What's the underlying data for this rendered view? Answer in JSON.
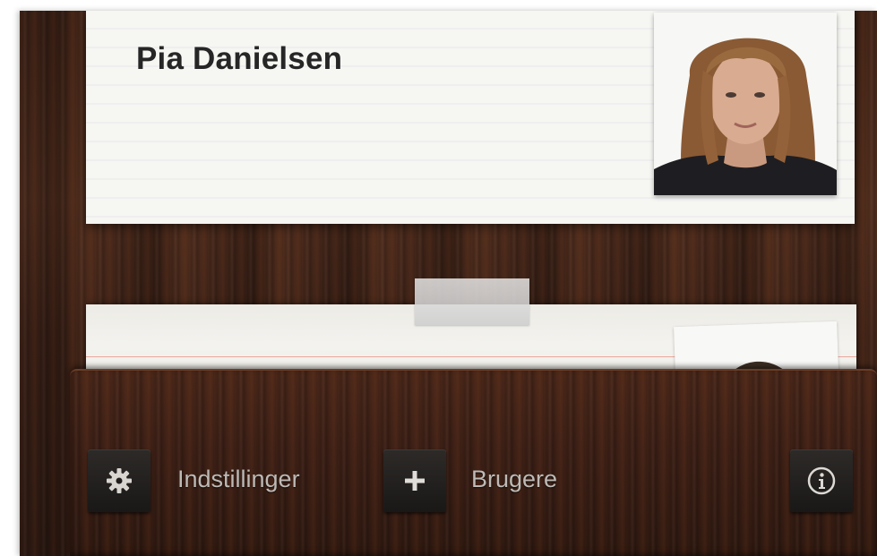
{
  "card": {
    "name": "Pia Danielsen"
  },
  "toolbar": {
    "settings_label": "Indstillinger",
    "users_label": "Brugere",
    "settings_icon": "gear-icon",
    "add_icon": "plus-icon",
    "info_icon": "info-icon"
  },
  "colors": {
    "wood_dark": "#3a2016",
    "card_paper": "#f6f6f3",
    "button_dark": "#1f1c1b",
    "label_gray": "#bdbab6"
  }
}
